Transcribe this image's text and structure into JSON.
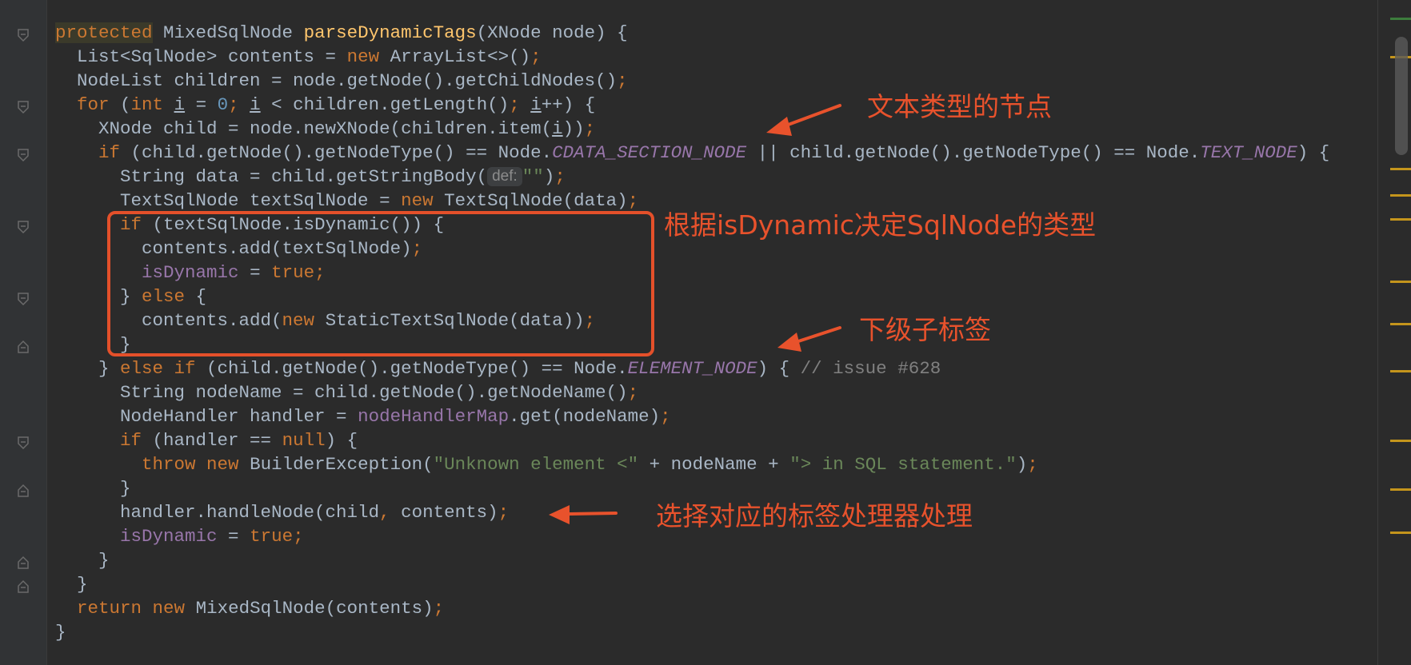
{
  "colors": {
    "background": "#2b2b2b",
    "keyword": "#cc7832",
    "method": "#ffc66d",
    "field": "#9876aa",
    "string": "#6a8759",
    "number": "#6897bb",
    "annotation": "#e8522c"
  },
  "code": {
    "l1": {
      "kw": "protected",
      "type": " MixedSqlNode ",
      "method": "parseDynamicTags",
      "rest": "(XNode node) {"
    },
    "l2": {
      "a": "  List<SqlNode> contents = ",
      "kw": "new",
      "b": " ArrayList<>()",
      "semi": ";"
    },
    "l3": {
      "a": "  NodeList children = node.getNode().getChildNodes()",
      "semi": ";"
    },
    "l4": {
      "kw1": "  for",
      "a": " (",
      "kw2": "int",
      "b": " ",
      "i1": "i",
      "c": " = ",
      "num": "0",
      "semi1": ";",
      "d": " ",
      "i2": "i",
      "e": " < children.getLength()",
      "semi2": ";",
      "f": " ",
      "i3": "i",
      "g": "++) {"
    },
    "l5": {
      "a": "    XNode child = node.newXNode(children.item(",
      "i": "i",
      "b": "))",
      "semi": ";"
    },
    "l6": {
      "kw": "    if",
      "a": " (child.getNode().getNodeType() == Node.",
      "f1": "CDATA_SECTION_NODE",
      "b": " || child.getNode().getNodeType() == Node.",
      "f2": "TEXT_NODE",
      "c": ") {"
    },
    "l7": {
      "a": "      String data = child.getStringBody(",
      "hint": "def:",
      "str": "\"\"",
      "b": ")",
      "semi": ";"
    },
    "l8": {
      "a": "      TextSqlNode textSqlNode = ",
      "kw": "new",
      "b": " TextSqlNode(data)",
      "semi": ";"
    },
    "l9": {
      "kw": "      if",
      "a": " (textSqlNode.isDynamic()) {"
    },
    "l10": {
      "a": "        contents.add(textSqlNode)",
      "semi": ";"
    },
    "l11": {
      "a": "        ",
      "f": "isDynamic",
      "b": " = ",
      "kw": "true",
      "semi": ";"
    },
    "l12": {
      "a": "      } ",
      "kw": "else",
      "b": " {"
    },
    "l13": {
      "a": "        contents.add(",
      "kw": "new",
      "b": " StaticTextSqlNode(data))",
      "semi": ";"
    },
    "l14": {
      "a": "      }"
    },
    "l15": {
      "a": "    } ",
      "kw1": "else if",
      "b": " (child.getNode().getNodeType() == Node.",
      "f": "ELEMENT_NODE",
      "c": ") { ",
      "cmt": "// issue #628"
    },
    "l16": {
      "a": "      String nodeName = child.getNode().getNodeName()",
      "semi": ";"
    },
    "l17": {
      "a": "      NodeHandler handler = ",
      "f": "nodeHandlerMap",
      "b": ".get(nodeName)",
      "semi": ";"
    },
    "l18": {
      "kw": "      if",
      "a": " (handler == ",
      "kw2": "null",
      "b": ") {"
    },
    "l19": {
      "kw1": "        throw",
      "sp": " ",
      "kw2": "new",
      "a": " BuilderException(",
      "s1": "\"Unknown element <\"",
      "b": " + nodeName + ",
      "s2": "\"> in SQL statement.\"",
      "c": ")",
      "semi": ";"
    },
    "l20": {
      "a": "      }"
    },
    "l21": {
      "a": "      handler.handleNode(child",
      "comma": ",",
      "b": " contents)",
      "semi": ";"
    },
    "l22": {
      "a": "      ",
      "f": "isDynamic",
      "b": " = ",
      "kw": "true",
      "semi": ";"
    },
    "l23": {
      "a": "    }"
    },
    "l24": {
      "a": "  }"
    },
    "l25": {
      "kw1": "  return",
      "sp": " ",
      "kw2": "new",
      "a": " MixedSqlNode(contents)",
      "semi": ";"
    },
    "l26": {
      "a": "}"
    }
  },
  "annotations": {
    "text_node": "文本类型的节点",
    "is_dynamic": "根据isDynamic决定SqlNode的类型",
    "child_tag": "下级子标签",
    "handler": "选择对应的标签处理器处理"
  }
}
